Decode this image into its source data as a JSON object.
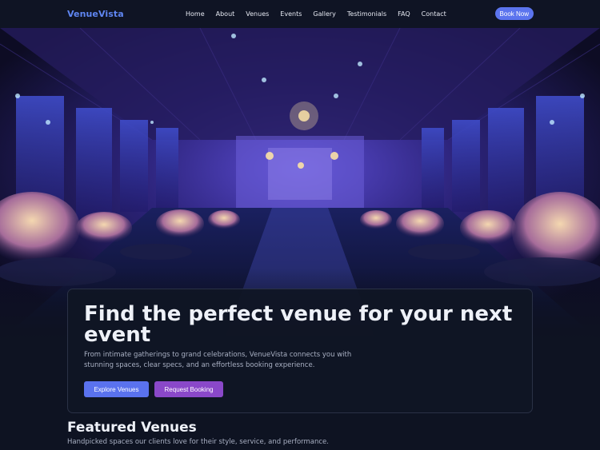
{
  "brand": "VenueVista",
  "nav": {
    "items": [
      "Home",
      "About",
      "Venues",
      "Events",
      "Gallery",
      "Testimonials",
      "FAQ",
      "Contact"
    ],
    "cta": "Book Now"
  },
  "hero": {
    "title": "Find the perfect venue for your next event",
    "description": "From intimate gatherings to grand celebrations, VenueVista connects you with stunning spaces, clear specs, and an effortless booking experience.",
    "primary_button": "Explore Venues",
    "secondary_button": "Request Booking"
  },
  "featured": {
    "title": "Featured Venues",
    "subtitle": "Handpicked spaces our clients love for their style, service, and performance."
  },
  "colors": {
    "accent": "#5b74ee",
    "secondary": "#8a48c9",
    "background": "#0e1322"
  }
}
